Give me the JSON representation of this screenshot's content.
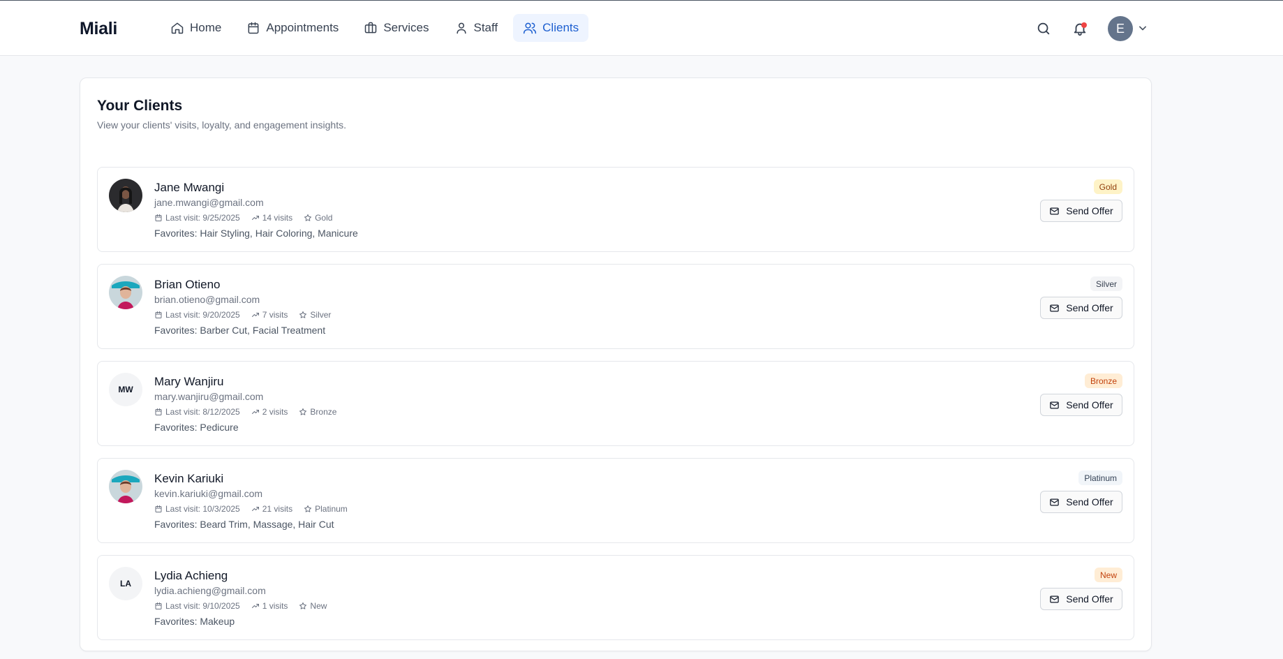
{
  "app": {
    "brand": "Miali"
  },
  "nav": [
    {
      "label": "Home",
      "icon": "home-icon",
      "active": false
    },
    {
      "label": "Appointments",
      "icon": "calendar-icon",
      "active": false
    },
    {
      "label": "Services",
      "icon": "briefcase-icon",
      "active": false
    },
    {
      "label": "Staff",
      "icon": "user-icon",
      "active": false
    },
    {
      "label": "Clients",
      "icon": "users-icon",
      "active": true
    }
  ],
  "header": {
    "avatar_initial": "E",
    "has_notification": true
  },
  "page": {
    "title": "Your Clients",
    "subtitle": "View your clients' visits, loyalty, and engagement insights."
  },
  "colors": {
    "accent": "#1d5fd0",
    "notification": "#ef4444"
  },
  "clients": [
    {
      "name": "Jane Mwangi",
      "email": "jane.mwangi@gmail.com",
      "last_visit": "Last visit: 9/25/2025",
      "visits": "14 visits",
      "tier": "Gold",
      "favorites": "Favorites: Hair Styling, Hair Coloring, Manicure",
      "badge": "Gold",
      "badge_bg": "#fef3c7",
      "badge_fg": "#92400e",
      "avatar": "photo-dark",
      "initials": "",
      "action": "Send Offer"
    },
    {
      "name": "Brian Otieno",
      "email": "brian.otieno@gmail.com",
      "last_visit": "Last visit: 9/20/2025",
      "visits": "7 visits",
      "tier": "Silver",
      "favorites": "Favorites: Barber Cut, Facial Treatment",
      "badge": "Silver",
      "badge_bg": "#f3f4f6",
      "badge_fg": "#374151",
      "avatar": "photo-teal",
      "initials": "",
      "action": "Send Offer"
    },
    {
      "name": "Mary Wanjiru",
      "email": "mary.wanjiru@gmail.com",
      "last_visit": "Last visit: 8/12/2025",
      "visits": "2 visits",
      "tier": "Bronze",
      "favorites": "Favorites: Pedicure",
      "badge": "Bronze",
      "badge_bg": "#ffedd5",
      "badge_fg": "#c2410c",
      "avatar": "initials",
      "initials": "MW",
      "action": "Send Offer"
    },
    {
      "name": "Kevin Kariuki",
      "email": "kevin.kariuki@gmail.com",
      "last_visit": "Last visit: 10/3/2025",
      "visits": "21 visits",
      "tier": "Platinum",
      "favorites": "Favorites: Beard Trim, Massage, Hair Cut",
      "badge": "Platinum",
      "badge_bg": "#f1f5f9",
      "badge_fg": "#334155",
      "avatar": "photo-teal",
      "initials": "",
      "action": "Send Offer"
    },
    {
      "name": "Lydia Achieng",
      "email": "lydia.achieng@gmail.com",
      "last_visit": "Last visit: 9/10/2025",
      "visits": "1 visits",
      "tier": "New",
      "favorites": "Favorites: Makeup",
      "badge": "New",
      "badge_bg": "#ffedd5",
      "badge_fg": "#c2410c",
      "avatar": "initials",
      "initials": "LA",
      "action": "Send Offer"
    }
  ]
}
